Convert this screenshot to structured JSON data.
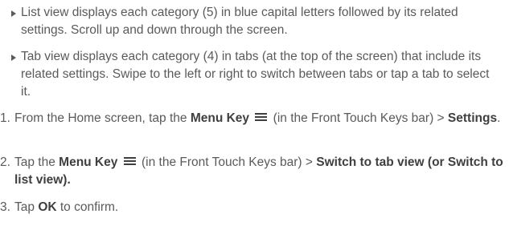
{
  "bullets": [
    {
      "text": "List view displays each category (5) in blue capital letters followed by its related settings. Scroll up and down through the screen."
    },
    {
      "text": "Tab view displays each category (4) in tabs (at the top of the screen) that include its related settings. Swipe to the left or right to switch between tabs or tap a tab to select it."
    }
  ],
  "steps": [
    {
      "number": "1.",
      "parts": {
        "a": "From the Home screen, tap the ",
        "b": "Menu Key",
        "c": " (in the Front Touch Keys bar) > ",
        "d": "Settings",
        "e": "."
      }
    },
    {
      "number": "2.",
      "parts": {
        "a": "Tap the ",
        "b": "Menu Key",
        "c": " (in the Front Touch Keys bar) > ",
        "d": "Switch to tab view (or Switch to list view)."
      }
    },
    {
      "number": "3.",
      "parts": {
        "a": "Tap ",
        "b": "OK",
        "c": " to confirm."
      }
    }
  ],
  "icons": {
    "bullet": "right-triangle-bullet-icon",
    "menu_key": "menu-key-icon"
  }
}
